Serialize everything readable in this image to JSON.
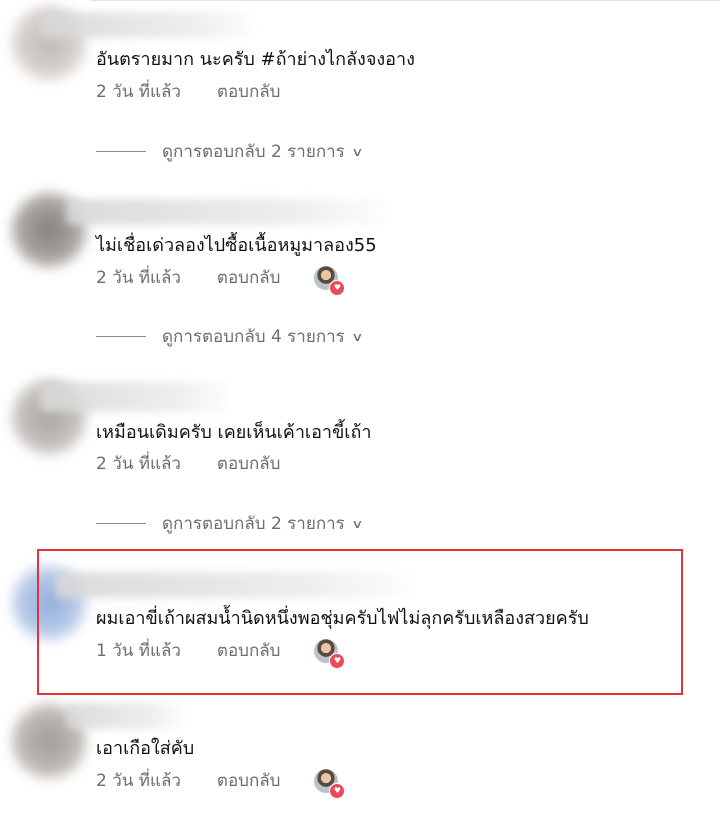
{
  "comments": [
    {
      "text": "อันตรายมาก นะครับ #ถ้าย่างไกลังจงอาง",
      "time": "2 วัน ที่แล้ว",
      "reply_label": "ตอบกลับ",
      "liked_by_author": false,
      "view_replies_label": "ดูการตอบกลับ 2 รายการ"
    },
    {
      "text": "ไม่เชื่อเด่วลองไปซื้อเนื้อหมูมาลอง55",
      "time": "2 วัน ที่แล้ว",
      "reply_label": "ตอบกลับ",
      "liked_by_author": true,
      "view_replies_label": "ดูการตอบกลับ 4 รายการ"
    },
    {
      "text": "เหมือนเดิมครับ เคยเห็นเค้าเอาขี้เถ้า",
      "time": "2 วัน ที่แล้ว",
      "reply_label": "ตอบกลับ",
      "liked_by_author": false,
      "view_replies_label": "ดูการตอบกลับ 2 รายการ"
    },
    {
      "text": "ผมเอาขี่เถ้าผสมน้ำนิดหนึ่งพอชุ่มครับไฟไม่ลุกครับเหลืองสวยครับ",
      "time": "1 วัน ที่แล้ว",
      "reply_label": "ตอบกลับ",
      "liked_by_author": true,
      "highlighted": true,
      "highlight_color": "#e0343a"
    },
    {
      "text": "เอาเกือใส่คับ",
      "time": "2 วัน ที่แล้ว",
      "reply_label": "ตอบกลับ",
      "liked_by_author": true
    }
  ],
  "icons": {
    "chevron": "chevron-down-icon",
    "heart": "heart-icon"
  },
  "colors": {
    "meta_text": "#6d6d6d",
    "heart": "#ed4956",
    "highlight": "#e0343a"
  }
}
